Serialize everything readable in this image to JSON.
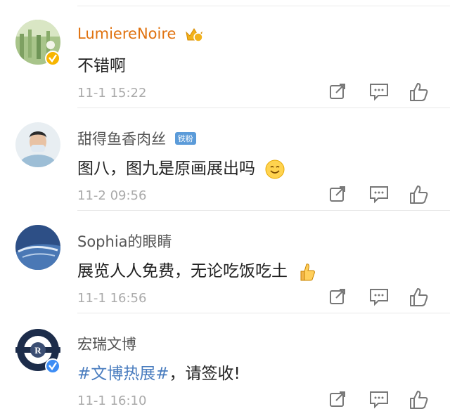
{
  "comments": [
    {
      "username": "LumiereNoire",
      "text": "不错啊",
      "time": "11-1 15:22",
      "verified": "gold",
      "badge": "crown-vip-badge"
    },
    {
      "username": "甜得鱼香肉丝",
      "fan_badge": "铁粉",
      "text": "图八，图九是原画展出吗",
      "emoji": "smile",
      "time": "11-2 09:56"
    },
    {
      "username": "Sophia的眼睛",
      "text": "展览人人免费，无论吃饭吃土",
      "emoji": "thumbs-up",
      "time": "11-1 16:56"
    },
    {
      "username": "宏瑞文博",
      "hashtag": "#文博热展#",
      "text_suffix": "，请签收!",
      "time": "11-1 16:10",
      "verified": "blue"
    }
  ],
  "colors": {
    "gold_name": "#e0720f",
    "hashtag": "#4a7dbf",
    "timestamp": "#aaaaaa",
    "fan_badge": "#5b9bd9"
  },
  "icons": [
    "share-icon",
    "comment-icon",
    "like-icon"
  ]
}
